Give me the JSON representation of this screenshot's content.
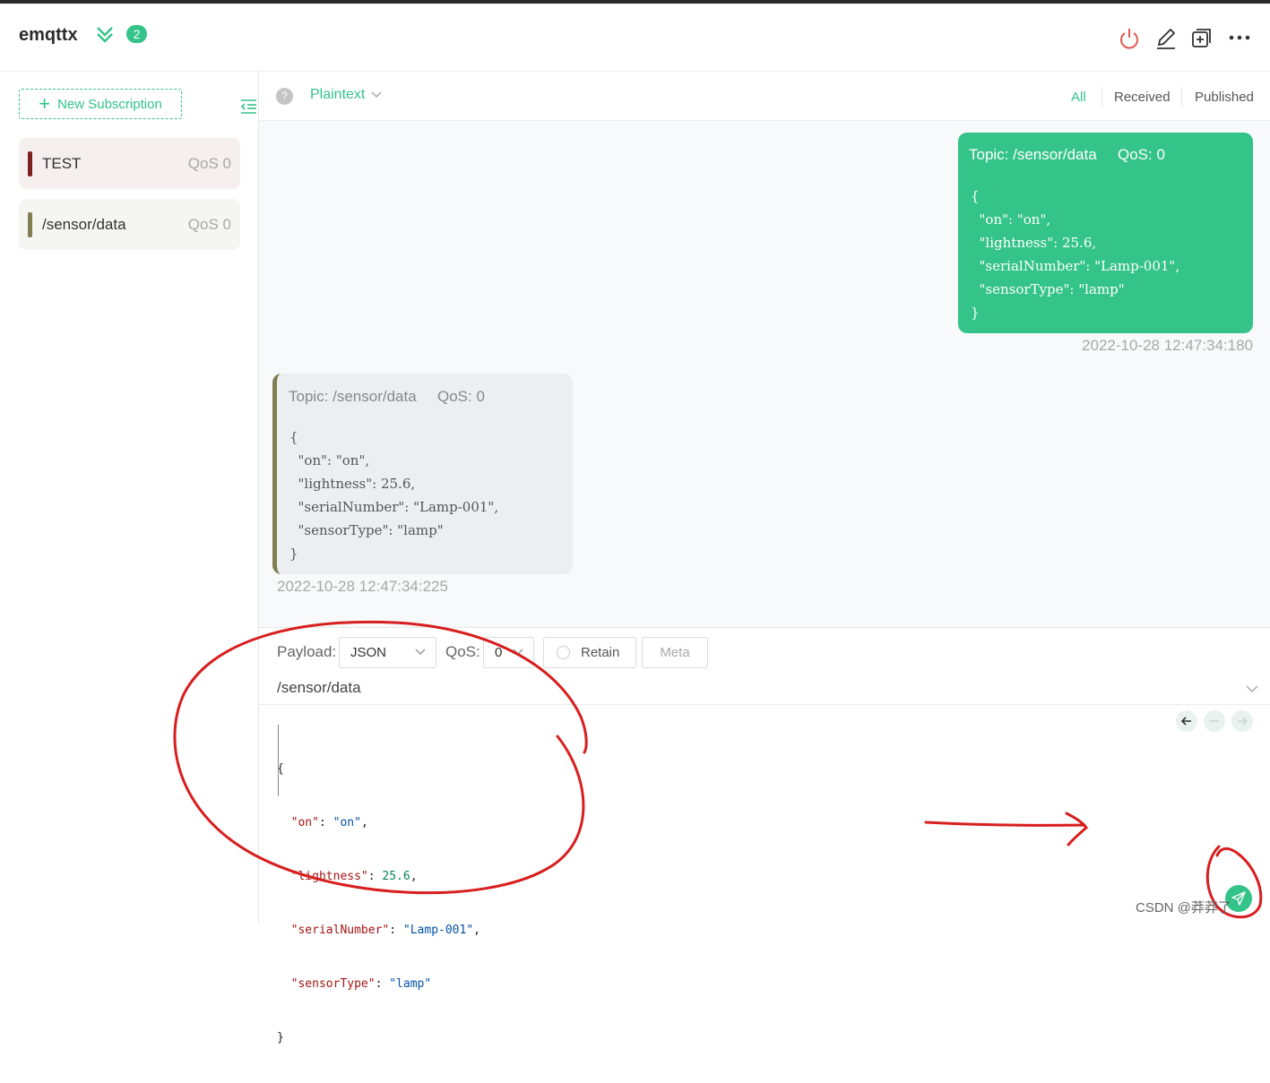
{
  "connection": {
    "name": "emqttx",
    "badge": "2"
  },
  "header_actions": [
    "power-icon",
    "edit-icon",
    "new-window-icon",
    "more-icon"
  ],
  "sidebar": {
    "new_subscription": "New Subscription",
    "subscriptions": [
      {
        "topic": "TEST",
        "qos": "QoS 0",
        "color": "#7a2222",
        "bg": "#f5efef"
      },
      {
        "topic": "/sensor/data",
        "qos": "QoS 0",
        "color": "#7f7f52",
        "bg": "#f5f5f2"
      }
    ]
  },
  "toolbar": {
    "format": "Plaintext",
    "filters": [
      "All",
      "Received",
      "Published"
    ],
    "active_filter": "All"
  },
  "messages": [
    {
      "direction": "published",
      "topic": "Topic: /sensor/data",
      "qos": "QoS: 0",
      "payload": "{\n  \"on\": \"on\",\n  \"lightness\": 25.6,\n  \"serialNumber\": \"Lamp-001\",\n  \"sensorType\": \"lamp\"\n}",
      "time": "2022-10-28 12:47:34:180"
    },
    {
      "direction": "received",
      "topic": "Topic: /sensor/data",
      "qos": "QoS: 0",
      "payload": "{\n  \"on\": \"on\",\n  \"lightness\": 25.6,\n  \"serialNumber\": \"Lamp-001\",\n  \"sensorType\": \"lamp\"\n}",
      "time": "2022-10-28 12:47:34:225"
    }
  ],
  "composer": {
    "payload_label": "Payload:",
    "payload_format": "JSON",
    "qos_label": "QoS:",
    "qos_value": "0",
    "retain_label": "Retain",
    "meta_label": "Meta",
    "topic": "/sensor/data",
    "editor": {
      "open": "{",
      "close": "}",
      "fields": [
        {
          "key": "\"on\"",
          "value": "\"on\"",
          "type": "string",
          "comma": ","
        },
        {
          "key": "\"lightness\"",
          "value": "25.6",
          "type": "number",
          "comma": ","
        },
        {
          "key": "\"serialNumber\"",
          "value": "\"Lamp-001\"",
          "type": "string",
          "comma": ","
        },
        {
          "key": "\"sensorType\"",
          "value": "\"lamp\"",
          "type": "string",
          "comma": ""
        }
      ]
    }
  },
  "watermark": "CSDN @莽莽了"
}
